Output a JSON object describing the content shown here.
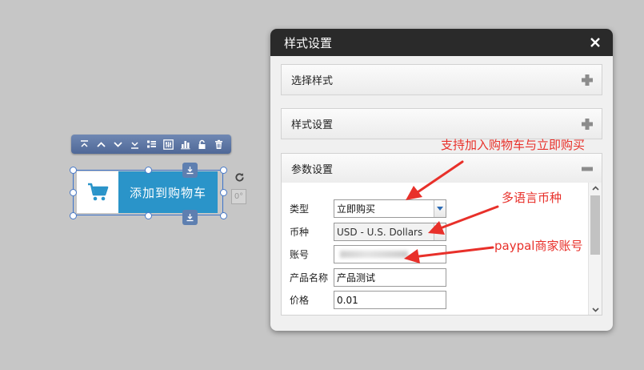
{
  "toolbar": {
    "icons": [
      "move-top-icon",
      "move-up-icon",
      "move-down-icon",
      "move-bottom-icon",
      "list-icon",
      "sliders-icon",
      "chart-icon",
      "lock-icon",
      "trash-icon"
    ]
  },
  "widget": {
    "button_label": "添加到购物车",
    "angle_label": "0°"
  },
  "dialog": {
    "title": "样式设置",
    "panels": [
      {
        "title": "选择样式",
        "state": "collapsed"
      },
      {
        "title": "样式设置",
        "state": "collapsed"
      },
      {
        "title": "参数设置",
        "state": "expanded"
      }
    ],
    "fields": {
      "type": {
        "label": "类型",
        "value": "立即购买"
      },
      "currency": {
        "label": "币种",
        "value": "USD - U.S. Dollars"
      },
      "account": {
        "label": "账号",
        "value": ""
      },
      "product_name": {
        "label": "产品名称",
        "value": "产品测试"
      },
      "price": {
        "label": "价格",
        "value": "0.01"
      }
    }
  },
  "annotations": {
    "cart_support": "支持加入购物车与立即购买",
    "multi_currency": "多语言币种",
    "paypal_account": "paypal商家账号"
  },
  "colors": {
    "accent": "#2a94c9",
    "annotation": "#e8302a",
    "dialog_header": "#2a2a2a",
    "toolbar": "#5a73a3"
  }
}
